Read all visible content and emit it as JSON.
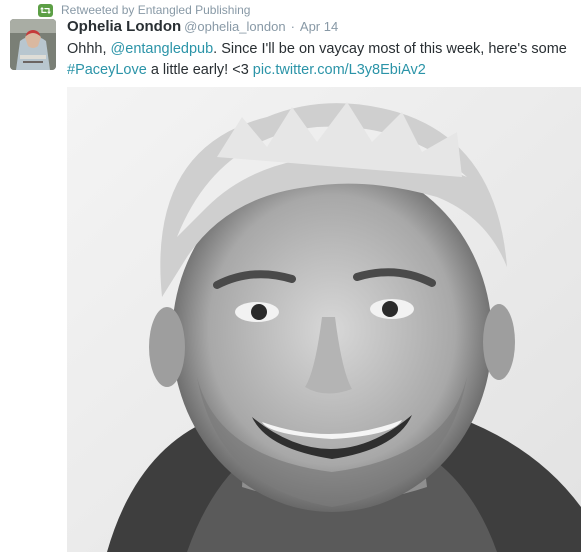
{
  "retweet": {
    "label": "Retweeted by Entangled Publishing",
    "icon": "retweet-icon",
    "icon_color": "#5c9f45"
  },
  "tweet": {
    "author_name": "Ophelia London",
    "author_handle": "@ophelia_london",
    "separator": "·",
    "date": "Apr 14",
    "text": {
      "prefix": "Ohhh, ",
      "mention": "@entangledpub",
      "middle": ". Since I'll be on vaycay most of this week, here's some ",
      "hashtag": "#PaceyLove",
      "middle2": " a little early! <3 ",
      "pic_link": "pic.twitter.com/L3y8EbiAv2"
    },
    "link_color": "#2b94a8"
  },
  "photo": {
    "description_icon": "photo-portrait"
  }
}
